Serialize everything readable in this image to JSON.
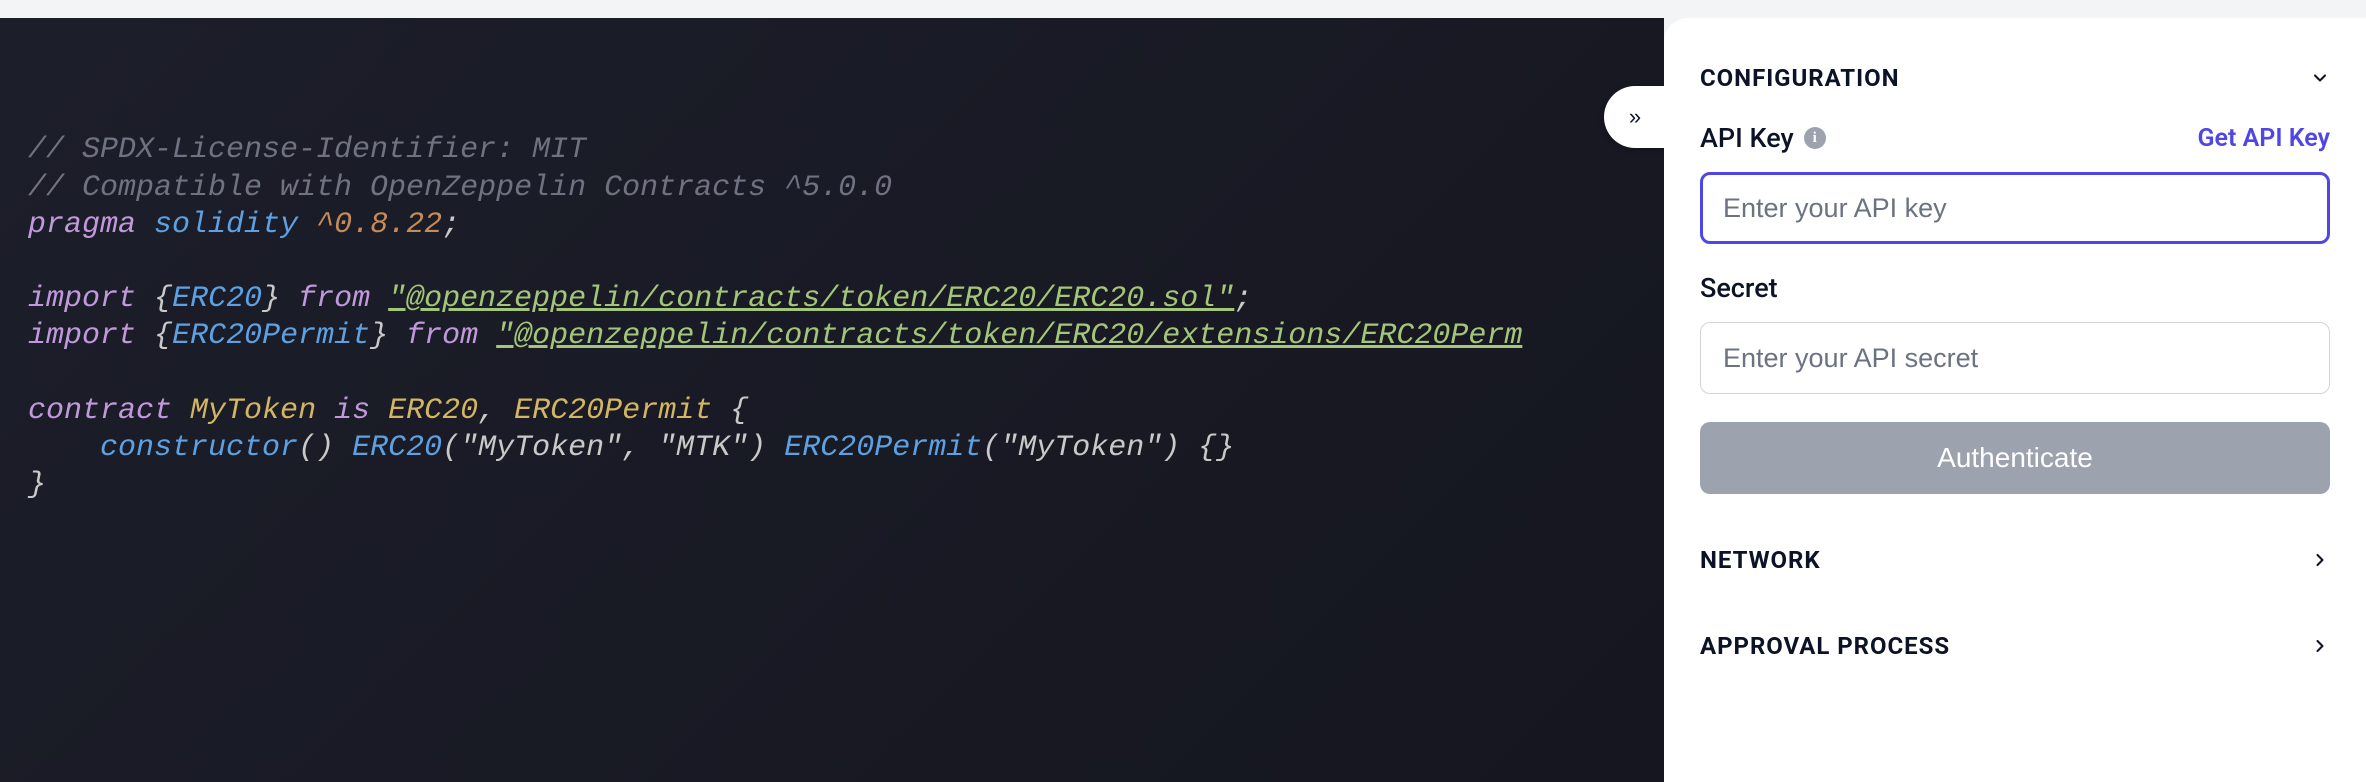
{
  "editor": {
    "collapse_glyph": "»",
    "code": {
      "comment1": "// SPDX-License-Identifier: MIT",
      "comment2": "// Compatible with OpenZeppelin Contracts ^5.0.0",
      "pragma_kw": "pragma",
      "solidity_kw": "solidity",
      "pragma_version": "^0.8.22",
      "semicolon": ";",
      "import_kw": "import",
      "from_kw": "from",
      "lbrace": "{",
      "rbrace": "}",
      "import1_symbol": "ERC20",
      "import1_path": "\"@openzeppelin/contracts/token/ERC20/ERC20.sol\"",
      "import2_symbol": "ERC20Permit",
      "import2_path": "\"@openzeppelin/contracts/token/ERC20/extensions/ERC20Perm",
      "contract_kw": "contract",
      "contract_name": "MyToken",
      "is_kw": "is",
      "inherit1": "ERC20",
      "comma": ",",
      "inherit2": "ERC20Permit",
      "lcurly": "{",
      "constructor_kw": "constructor",
      "parens": "()",
      "erc20_call": "ERC20",
      "erc20_args": "(\"MyToken\", \"MTK\")",
      "permit_call": "ERC20Permit",
      "permit_args": "(\"MyToken\")",
      "empty_body": "{}",
      "rcurly": "}"
    }
  },
  "panel": {
    "sections": {
      "configuration": {
        "title": "CONFIGURATION",
        "apiKey": {
          "label": "API Key",
          "getLink": "Get API Key",
          "placeholder": "Enter your API key",
          "value": ""
        },
        "secret": {
          "label": "Secret",
          "placeholder": "Enter your API secret",
          "value": ""
        },
        "authenticate_label": "Authenticate"
      },
      "network": {
        "title": "NETWORK"
      },
      "approval": {
        "title": "APPROVAL PROCESS"
      }
    }
  }
}
